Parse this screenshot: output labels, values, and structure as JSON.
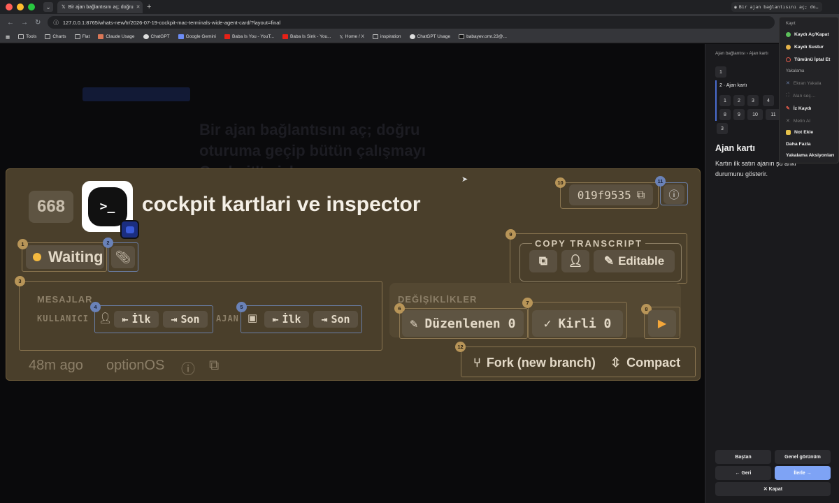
{
  "browser": {
    "tab_title": "Bir ajan bağlantısını aç; doğru",
    "right_tab_title": "Bir ajan bağlantısını aç; do…",
    "url": "127.0.0.1:8765/whats-new/tr/2026-07-19-cockpit-mac-terminals-wide-agent-card/?layout=final",
    "bookmarks": [
      "Tools",
      "Charts",
      "Flat",
      "Claude Usage",
      "ChatGPT",
      "Google Gemini",
      "Baba Is You - YouT...",
      "Baba Is Sink - You...",
      "Home / X",
      "inspiration",
      "ChatGPT Usage",
      "babayev.omr.23@..."
    ]
  },
  "background": {
    "ghost_title": "Bir ajan bağlantısını aç; doğru oturuma geçip bütün çalışmayı Cockpit'te izle"
  },
  "card": {
    "number": "668",
    "app_icon_glyph": ">_",
    "title": "cockpit kartlari ve inspector",
    "hash": "019f9535",
    "status": "Waiting",
    "copy_transcript": {
      "label": "COPY TRANSCRIPT",
      "editable_label": "Editable"
    },
    "messages": {
      "label": "MESAJLAR",
      "user_label": "KULLANICI",
      "agent_label": "AJAN",
      "first": "İlk",
      "last": "Son"
    },
    "changes": {
      "label": "DEĞİŞİKLİKLER",
      "edited": "Düzenlenen 0",
      "dirty": "Kirli 0"
    },
    "footer": {
      "time": "48m ago",
      "host": "optionOS"
    },
    "actions": {
      "fork": "Fork (new branch)",
      "compact": "Compact"
    },
    "badges": [
      "1",
      "2",
      "3",
      "4",
      "5",
      "6",
      "7",
      "8",
      "9",
      "10",
      "11",
      "12"
    ]
  },
  "sidepanel": {
    "breadcrumb": "Ajan bağlantısı › Ajan kartı",
    "step1": "1",
    "step2_label": "2 · Ajan kartı",
    "substeps_row1": [
      "1",
      "2",
      "3",
      "4"
    ],
    "substeps_row2": [
      "8",
      "9",
      "10",
      "11"
    ],
    "step3": "3",
    "title": "Ajan kartı",
    "description": "Kartın ilk satırı ajanın şu anki durumunu gösterir.",
    "buttons": {
      "restart": "Baştan",
      "overview": "Genel görünüm",
      "back": "← Geri",
      "next": "İlerle →",
      "close": "✕ Kapat"
    }
  },
  "menu": {
    "section_record": "Kayıt",
    "record_toggle": "Kaydı Aç/Kapat",
    "record_mute": "Kaydı Sustur",
    "cancel_all": "Tümünü İptal Et",
    "section_capture": "Yakalama",
    "screen_capture": "Ekran Yakala",
    "area_select": "Alan seç…",
    "trace_record": "İz Kaydı",
    "take_text": "Metin Al",
    "add_note": "Not Ekle",
    "section_more": "Daha Fazla",
    "capture_actions": "Yakalama Aksiyonları"
  }
}
